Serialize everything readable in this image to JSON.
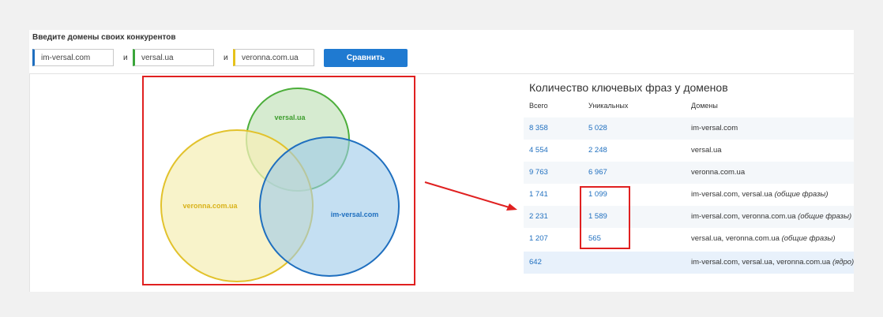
{
  "form": {
    "prompt": "Введите домены своих конкурентов",
    "inputs": [
      {
        "value": "im-versal.com",
        "color": "#1f6fbf"
      },
      {
        "value": "versal.ua",
        "color": "#3aa63a"
      },
      {
        "value": "veronna.com.ua",
        "color": "#e6c21a"
      }
    ],
    "and_label": "и",
    "compare_button": "Сравнить"
  },
  "venn": {
    "circles": [
      {
        "label": "versal.ua",
        "fill": "#cfe8c8",
        "stroke": "#4cae3a",
        "text_color": "#3e9d2e"
      },
      {
        "label": "veronna.com.ua",
        "fill": "#f6efb8",
        "stroke": "#e2c22c",
        "text_color": "#d9b21a"
      },
      {
        "label": "im-versal.com",
        "fill": "#b3d6ee",
        "stroke": "#1f6fbf",
        "text_color": "#1f6fbf"
      }
    ]
  },
  "table": {
    "title": "Количество ключевых фраз у доменов",
    "headers": {
      "total": "Всего",
      "unique": "Уникальных",
      "domains": "Домены"
    },
    "rows": [
      {
        "total": "8 358",
        "unique": "5 028",
        "domains": "im-versal.com",
        "note": ""
      },
      {
        "total": "4 554",
        "unique": "2 248",
        "domains": "versal.ua",
        "note": ""
      },
      {
        "total": "9 763",
        "unique": "6 967",
        "domains": "veronna.com.ua",
        "note": ""
      },
      {
        "total": "1 741",
        "unique": "1 099",
        "domains": "im-versal.com, versal.ua",
        "note": "(общие фразы)"
      },
      {
        "total": "2 231",
        "unique": "1 589",
        "domains": "im-versal.com, veronna.com.ua",
        "note": "(общие фразы)"
      },
      {
        "total": "1 207",
        "unique": "565",
        "domains": "versal.ua, veronna.com.ua",
        "note": "(общие фразы)"
      },
      {
        "total": "642",
        "unique": "",
        "domains": "im-versal.com, versal.ua, veronna.com.ua",
        "note": "(ядро)"
      }
    ]
  },
  "colors": {
    "accent": "#1f7ad1",
    "highlight": "#e02020"
  }
}
